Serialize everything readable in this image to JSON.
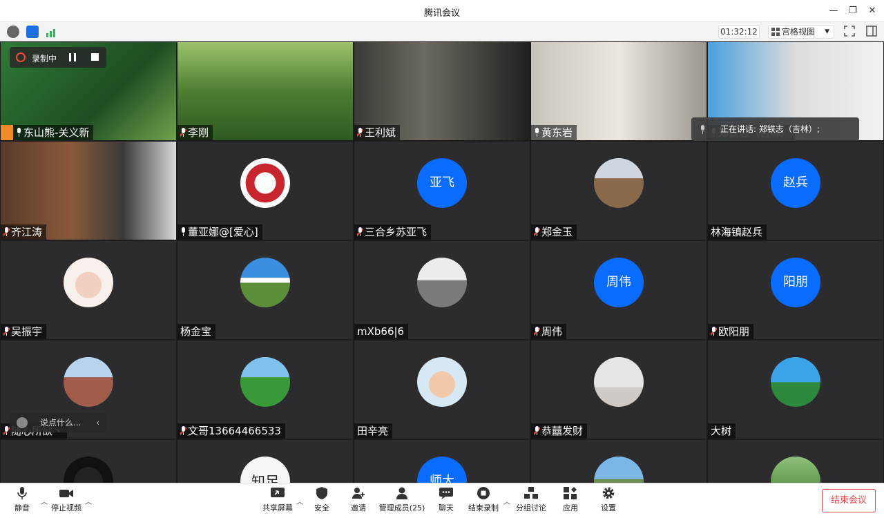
{
  "window": {
    "title": "腾讯会议"
  },
  "topbar": {
    "timer": "01:32:12",
    "view_label": "宫格视图"
  },
  "recording": {
    "label": "录制中"
  },
  "speaking": {
    "text": "正在讲话: 郑铁志（吉林）;"
  },
  "chat": {
    "placeholder": "说点什么..."
  },
  "participants": [
    {
      "name": "东山熊-关义新",
      "mic": "on",
      "avatar_text": "",
      "host": true
    },
    {
      "name": "李刚",
      "mic": "muted",
      "avatar_text": ""
    },
    {
      "name": "王利斌",
      "mic": "muted",
      "avatar_text": ""
    },
    {
      "name": "黄东岩",
      "mic": "on",
      "avatar_text": ""
    },
    {
      "name": "郑铁志（吉林）",
      "mic": "on",
      "avatar_text": ""
    },
    {
      "name": "齐江涛",
      "mic": "muted",
      "avatar_text": ""
    },
    {
      "name": "董亚娜@[爱心]",
      "mic": "on",
      "avatar_text": ""
    },
    {
      "name": "三合乡苏亚飞",
      "mic": "muted",
      "avatar_text": "亚飞"
    },
    {
      "name": "郑金玉",
      "mic": "muted",
      "avatar_text": ""
    },
    {
      "name": "林海镇赵兵",
      "mic": "none",
      "avatar_text": "赵兵"
    },
    {
      "name": "吴振宇",
      "mic": "muted",
      "avatar_text": ""
    },
    {
      "name": "杨金宝",
      "mic": "none",
      "avatar_text": ""
    },
    {
      "name": "mXb66|6",
      "mic": "none",
      "avatar_text": ""
    },
    {
      "name": "周伟",
      "mic": "muted",
      "avatar_text": "周伟"
    },
    {
      "name": "欧阳朋",
      "mic": "muted",
      "avatar_text": "阳朋"
    },
    {
      "name": "随心所欲丶",
      "mic": "muted",
      "avatar_text": ""
    },
    {
      "name": "文哥13664466533",
      "mic": "muted",
      "avatar_text": ""
    },
    {
      "name": "田辛亮",
      "mic": "none",
      "avatar_text": ""
    },
    {
      "name": "恭囍发财",
      "mic": "muted",
      "avatar_text": ""
    },
    {
      "name": "大树",
      "mic": "none",
      "avatar_text": ""
    },
    {
      "name": "",
      "mic": "none",
      "avatar_text": ""
    },
    {
      "name": "",
      "mic": "none",
      "avatar_text": "知足"
    },
    {
      "name": "",
      "mic": "none",
      "avatar_text": "师大"
    },
    {
      "name": "",
      "mic": "none",
      "avatar_text": ""
    },
    {
      "name": "",
      "mic": "none",
      "avatar_text": ""
    }
  ],
  "bottombar": {
    "mute": "静音",
    "stop_video": "停止视频",
    "share_screen": "共享屏幕",
    "security": "安全",
    "invite": "邀请",
    "manage_members": "管理成员(25)",
    "chat": "聊天",
    "end_recording": "结束录制",
    "breakout": "分组讨论",
    "apps": "应用",
    "settings": "设置",
    "end_meeting": "结束会议"
  },
  "colors": {
    "accent": "#0a6cff",
    "danger": "#e64a4a",
    "tile_bg": "#2c2c2e"
  }
}
